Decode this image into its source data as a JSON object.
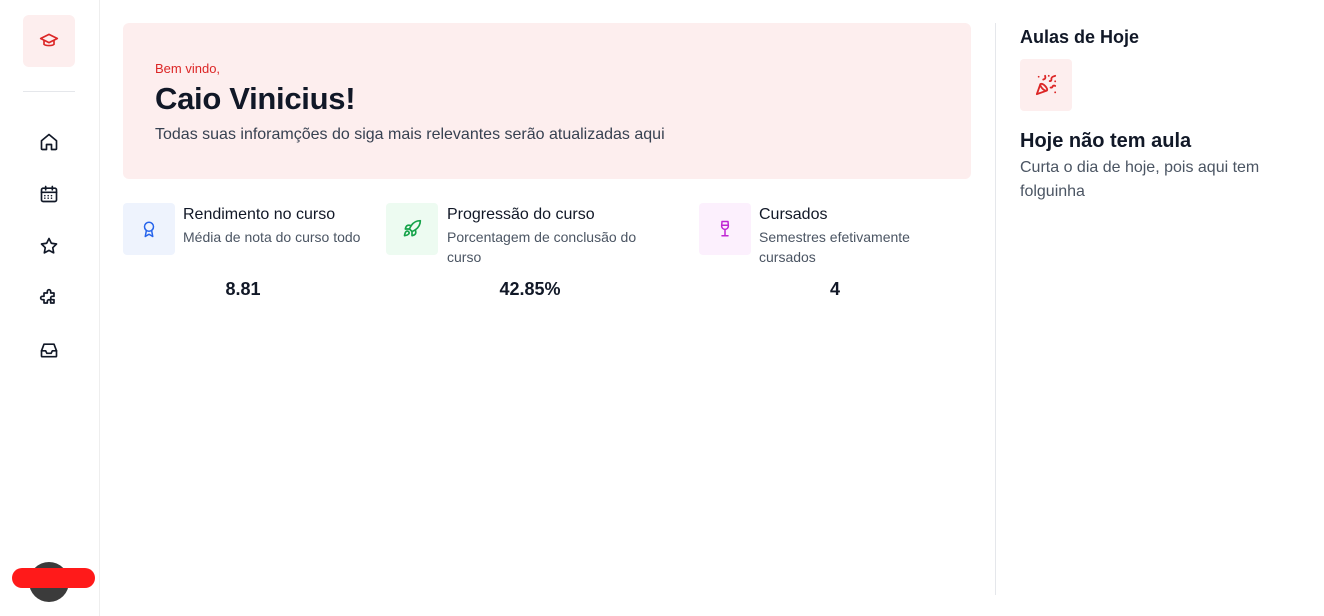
{
  "sidebar": {
    "logo_icon": "graduation-cap-icon",
    "items": [
      {
        "icon": "home-icon"
      },
      {
        "icon": "calendar-icon"
      },
      {
        "icon": "star-icon"
      },
      {
        "icon": "puzzle-icon"
      },
      {
        "icon": "inbox-icon"
      }
    ]
  },
  "banner": {
    "greeting": "Bem vindo,",
    "name": "Caio Vinicius!",
    "description": "Todas suas inforamções do siga mais relevantes serão atualizadas aqui"
  },
  "stats": [
    {
      "icon": "award-icon",
      "title": "Rendimento no curso",
      "subtitle": "Média de nota do curso todo",
      "value": "8.81",
      "color": "#2563eb",
      "bg": "#eef3fd"
    },
    {
      "icon": "rocket-icon",
      "title": "Progressão do curso",
      "subtitle": "Porcentagem de conclusão do curso",
      "value": "42.85%",
      "color": "#16a34a",
      "bg": "#edfbf1"
    },
    {
      "icon": "wine-glass-icon",
      "title": "Cursados",
      "subtitle": "Semestres efetivamente cursados",
      "value": "4",
      "color": "#c026d3",
      "bg": "#fcf0fd"
    }
  ],
  "today": {
    "title": "Aulas de Hoje",
    "icon": "party-popper-icon",
    "empty_title": "Hoje não tem aula",
    "empty_desc": "Curta o dia de hoje, pois aqui tem folguinha"
  },
  "colors": {
    "accent": "#dc2626",
    "accent_bg": "#fdeeee"
  }
}
